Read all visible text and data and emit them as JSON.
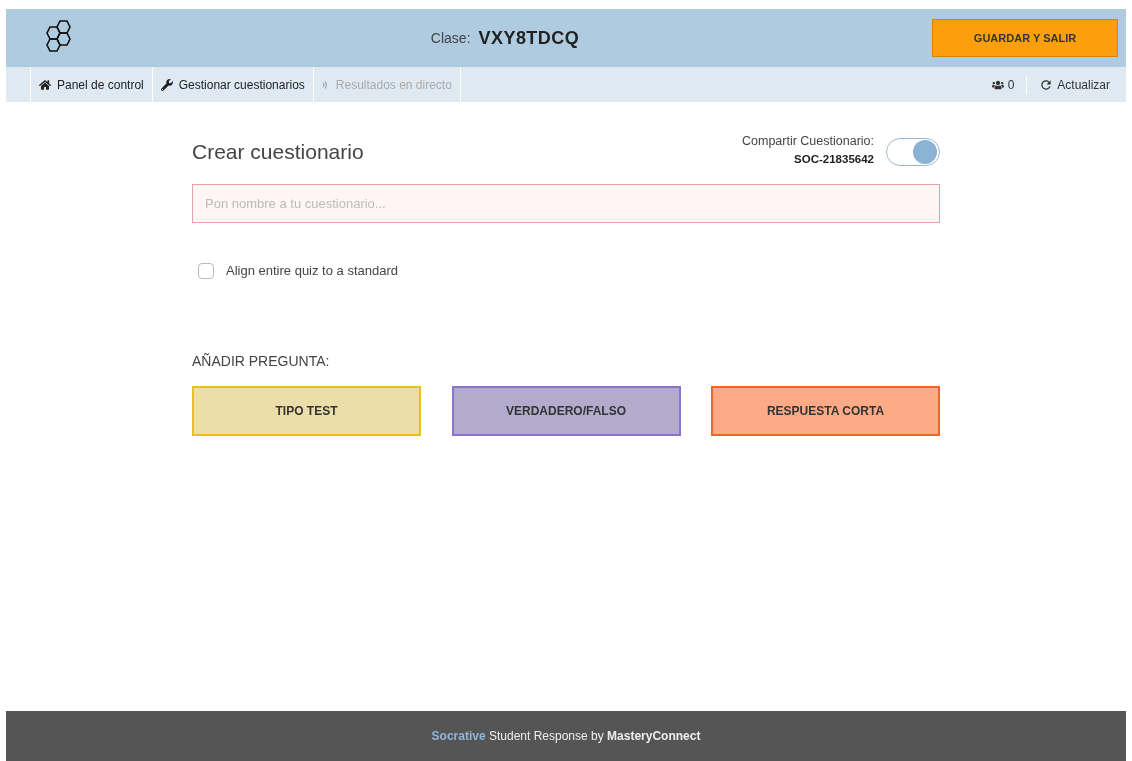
{
  "header": {
    "class_label": "Clase:",
    "class_code": "VXY8TDCQ",
    "save_button": "GUARDAR Y SALIR"
  },
  "nav": {
    "items": [
      {
        "kind": "home",
        "label": "Panel de control",
        "disabled": false
      },
      {
        "kind": "wrench",
        "label": "Gestionar cuestionarios",
        "disabled": false
      },
      {
        "kind": "live",
        "label": "Resultados en directo",
        "disabled": true
      }
    ],
    "students": "0",
    "refresh": "Actualizar"
  },
  "title": "Crear cuestionario",
  "share": {
    "label": "Compartir Cuestionario:",
    "code": "SOC-21835642",
    "on": true
  },
  "name_field": {
    "placeholder": "Pon nombre a tu cuestionario..."
  },
  "align": {
    "label": "Align entire quiz to a standard",
    "checked": false
  },
  "add_question": {
    "label": "AÑADIR PREGUNTA:",
    "types": [
      {
        "label": "TIPO TEST",
        "color": "#ecdea8"
      },
      {
        "label": "VERDADERO/FALSO",
        "color": "#b2abcb"
      },
      {
        "label": "RESPUESTA CORTA",
        "color": "#fdaa86"
      }
    ]
  },
  "footer": {
    "text": "**Socrative** Student Response by **MasteryConnect**"
  }
}
